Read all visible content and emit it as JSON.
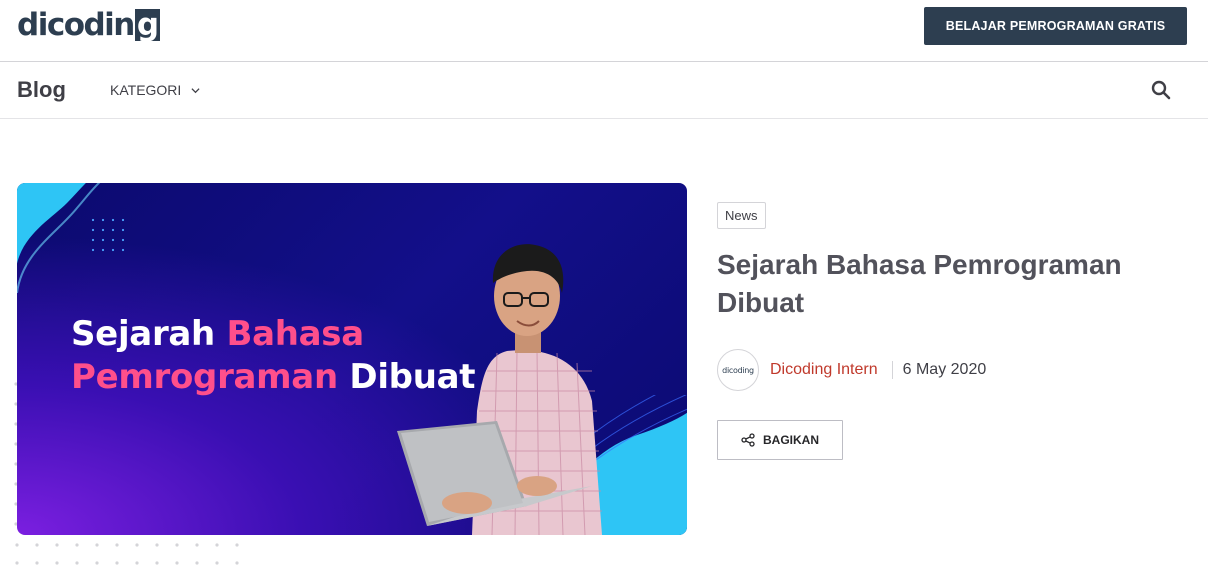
{
  "header": {
    "logo_text": "dicodin",
    "logo_last": "g",
    "cta_label": "BELAJAR PEMROGRAMAN GRATIS"
  },
  "nav": {
    "title": "Blog",
    "kategori_label": "KATEGORI",
    "icons": {
      "dropdown": "chevron-down-icon",
      "search": "search-icon"
    }
  },
  "hero": {
    "line1_white": "Sejarah ",
    "line1_pink": "Bahasa",
    "line2_pink": "Pemrograman",
    "line2_white": " Dibuat",
    "colors": {
      "pink": "#ff4f8b",
      "bg": "#130f8a",
      "cyan": "#2ec5f5"
    }
  },
  "article": {
    "tag": "News",
    "title": "Sejarah Bahasa Pemrograman Dibuat",
    "avatar_text": "dicoding",
    "author": "Dicoding Intern",
    "date": "6 May 2020",
    "share_label": "BAGIKAN",
    "share_icon": "share-icon"
  },
  "colors": {
    "brand": "#2d3e50",
    "author": "#c0392b"
  }
}
